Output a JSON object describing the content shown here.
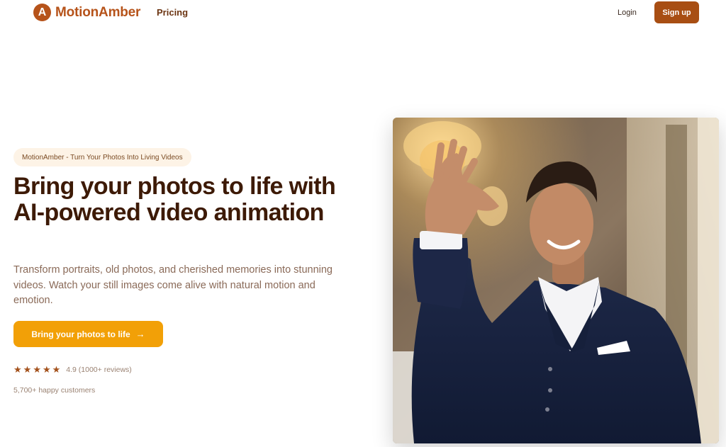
{
  "header": {
    "logo_letter": "A",
    "brand": "MotionAmber",
    "nav_pricing": "Pricing",
    "login": "Login",
    "signup": "Sign up"
  },
  "hero": {
    "badge": "MotionAmber - Turn Your Photos Into Living Videos",
    "headline": "Bring your photos to life with AI-powered video animation",
    "subtext": "Transform portraits, old photos, and cherished memories into stunning videos. Watch your still images come alive with natural motion and emotion.",
    "cta_label": "Bring your photos to life",
    "cta_arrow": "→",
    "rating_stars": 5,
    "rating_text": "4.9 (1000+ reviews)",
    "customers": "5,700+ happy customers"
  },
  "colors": {
    "brand": "#b6531a",
    "signup_bg": "#a84e13",
    "cta_bg": "#f2a007",
    "heading": "#3d1a06",
    "star": "#a3501a"
  },
  "icons": {
    "logo": "letter-a-circle-icon",
    "cta_arrow": "arrow-right-icon",
    "star": "star-icon"
  }
}
